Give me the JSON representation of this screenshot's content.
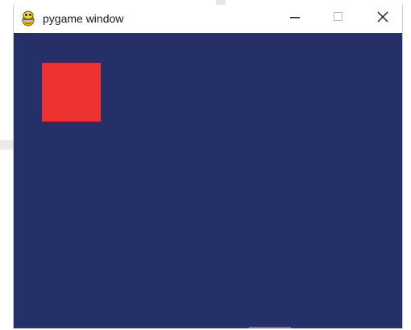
{
  "window": {
    "title": "pygame window",
    "icon": "pygame-snake-icon",
    "controls": {
      "minimize_icon": "minimize-icon",
      "maximize_icon": "maximize-icon",
      "close_icon": "close-icon"
    }
  },
  "canvas": {
    "background_color": "#253068",
    "shapes": [
      {
        "kind": "rectangle",
        "color": "#ee3131"
      }
    ]
  },
  "colors": {
    "titlebar": "#ffffff",
    "title_text": "#1a1a1a",
    "canvas_bg": "#253068",
    "rect_fill": "#ee3131"
  }
}
